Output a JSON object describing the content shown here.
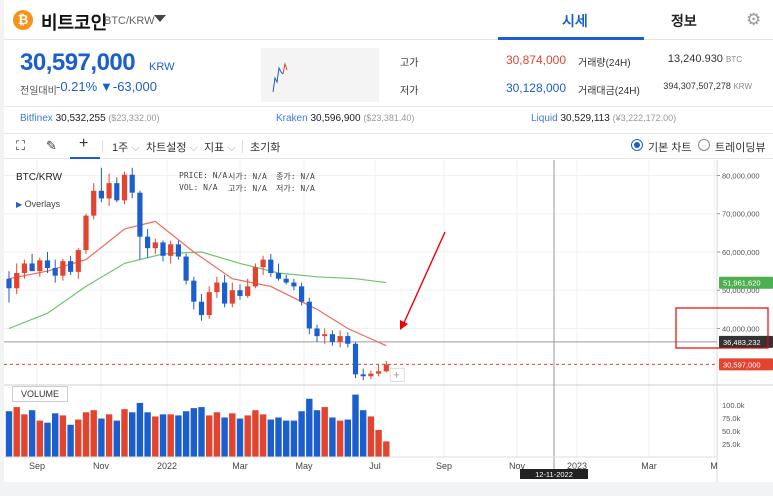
{
  "header": {
    "coin_symbol": "₿",
    "coin_name": "비트코인",
    "coin_pair": "BTC/KRW",
    "tabs": [
      {
        "label": "시세",
        "active": true
      },
      {
        "label": "정보",
        "active": false
      }
    ],
    "settings_icon": "gear-icon"
  },
  "price": {
    "current": "30,597,000",
    "unit": "KRW",
    "change_label": "전일대비",
    "change_pct": "-0.21%",
    "change_amount": "▼-63,000",
    "high_label": "고가",
    "high": "30,874,000",
    "low_label": "저가",
    "low": "30,128,000",
    "volume_label": "거래량(24H)",
    "volume": "13,240.930",
    "volume_unit": "BTC",
    "turnover_label": "거래대금(24H)",
    "turnover": "394,307,507,278",
    "turnover_unit": "KRW"
  },
  "exchanges": [
    {
      "name": "Bitfinex",
      "price": "30,532,255",
      "usd": "($23,332.00)"
    },
    {
      "name": "Kraken",
      "price": "30,596,900",
      "usd": "($23,381.40)"
    },
    {
      "name": "Liquid",
      "price": "30,529,113",
      "usd": "(¥3,222,172.00)"
    }
  ],
  "toolbar": {
    "fullscreen_icon": "fullscreen-icon",
    "pencil_icon": "pencil-icon",
    "crosshair_icon": "crosshair-icon",
    "interval": "1주",
    "chart_settings": "차트설정",
    "indicators": "지표",
    "reset": "초기화",
    "basic_chart": "기본 차트",
    "tradingview": "트레이딩뷰"
  },
  "chart_data": {
    "type": "candlestick",
    "title": "BTC/KRW",
    "overlays_label": "Overlays",
    "ohlc_labels": {
      "price": "PRICE:",
      "open": "시가:",
      "close": "종가:",
      "vol": "VOL:",
      "high": "고가:",
      "low": "저가:",
      "na": "N/A"
    },
    "volume_label": "VOLUME",
    "y_ticks": [
      "80,000,000",
      "70,000,000",
      "60,000,000",
      "50,000,000",
      "40,000,000"
    ],
    "y_range": [
      26000000,
      83000000
    ],
    "volume_ticks": [
      "100.0k",
      "75.0k",
      "50.0k",
      "25.0k"
    ],
    "volume_range": [
      0,
      125000
    ],
    "x_ticks": [
      "Sep",
      "Nov",
      "2022",
      "Mar",
      "May",
      "Jul",
      "Sep",
      "Nov",
      "2023",
      "Mar",
      "M"
    ],
    "crosshair_date": "12-11-2022",
    "crosshair_value": "36,483,232",
    "current_price_tag": "30,597,000",
    "current_price": 30597000,
    "ma_tag": "51,961,620",
    "up_color": "#e2442f",
    "down_color": "#1b5fce",
    "ma_short_color": "#f2685a",
    "ma_long_color": "#6cc56c",
    "candles": [
      {
        "o": 53.0,
        "h": 55.0,
        "l": 46.8,
        "c": 50.5
      },
      {
        "o": 50.5,
        "h": 57.0,
        "l": 49.0,
        "c": 54.5
      },
      {
        "o": 54.5,
        "h": 58.0,
        "l": 53.0,
        "c": 57.0
      },
      {
        "o": 57.0,
        "h": 59.5,
        "l": 55.0,
        "c": 55.0
      },
      {
        "o": 55.0,
        "h": 58.5,
        "l": 53.5,
        "c": 57.8
      },
      {
        "o": 57.8,
        "h": 60.0,
        "l": 54.5,
        "c": 55.8
      },
      {
        "o": 55.8,
        "h": 58.0,
        "l": 52.0,
        "c": 53.8
      },
      {
        "o": 53.8,
        "h": 58.2,
        "l": 52.5,
        "c": 57.6
      },
      {
        "o": 57.6,
        "h": 59.0,
        "l": 54.0,
        "c": 54.8
      },
      {
        "o": 54.8,
        "h": 61.0,
        "l": 53.0,
        "c": 60.5
      },
      {
        "o": 60.5,
        "h": 70.0,
        "l": 59.5,
        "c": 69.5
      },
      {
        "o": 69.5,
        "h": 78.0,
        "l": 68.5,
        "c": 76.0
      },
      {
        "o": 76.0,
        "h": 82.0,
        "l": 73.0,
        "c": 74.0
      },
      {
        "o": 74.0,
        "h": 80.5,
        "l": 72.0,
        "c": 78.0
      },
      {
        "o": 78.0,
        "h": 79.5,
        "l": 73.0,
        "c": 73.5
      },
      {
        "o": 73.5,
        "h": 81.0,
        "l": 72.5,
        "c": 80.2
      },
      {
        "o": 80.2,
        "h": 82.0,
        "l": 74.0,
        "c": 75.5
      },
      {
        "o": 75.5,
        "h": 76.0,
        "l": 58.0,
        "c": 64.0
      },
      {
        "o": 64.0,
        "h": 66.0,
        "l": 58.5,
        "c": 61.0
      },
      {
        "o": 61.0,
        "h": 63.5,
        "l": 59.5,
        "c": 62.5
      },
      {
        "o": 62.5,
        "h": 63.0,
        "l": 57.5,
        "c": 59.0
      },
      {
        "o": 59.0,
        "h": 63.0,
        "l": 57.0,
        "c": 62.0
      },
      {
        "o": 62.0,
        "h": 63.0,
        "l": 58.0,
        "c": 58.8
      },
      {
        "o": 58.8,
        "h": 59.5,
        "l": 51.5,
        "c": 52.5
      },
      {
        "o": 52.5,
        "h": 53.5,
        "l": 45.0,
        "c": 47.0
      },
      {
        "o": 47.0,
        "h": 49.0,
        "l": 42.0,
        "c": 43.5
      },
      {
        "o": 43.5,
        "h": 51.0,
        "l": 42.5,
        "c": 49.5
      },
      {
        "o": 49.5,
        "h": 53.5,
        "l": 48.0,
        "c": 52.0
      },
      {
        "o": 52.0,
        "h": 54.0,
        "l": 45.5,
        "c": 46.5
      },
      {
        "o": 46.5,
        "h": 52.0,
        "l": 45.5,
        "c": 50.0
      },
      {
        "o": 50.0,
        "h": 51.5,
        "l": 47.5,
        "c": 48.5
      },
      {
        "o": 48.5,
        "h": 53.0,
        "l": 48.0,
        "c": 51.0
      },
      {
        "o": 51.0,
        "h": 57.0,
        "l": 50.5,
        "c": 56.0
      },
      {
        "o": 56.0,
        "h": 59.0,
        "l": 54.0,
        "c": 58.0
      },
      {
        "o": 58.0,
        "h": 59.5,
        "l": 53.5,
        "c": 54.5
      },
      {
        "o": 54.5,
        "h": 57.0,
        "l": 52.5,
        "c": 53.0
      },
      {
        "o": 53.0,
        "h": 54.0,
        "l": 51.5,
        "c": 52.0
      },
      {
        "o": 52.0,
        "h": 53.0,
        "l": 50.0,
        "c": 51.0
      },
      {
        "o": 51.0,
        "h": 52.0,
        "l": 46.0,
        "c": 47.0
      },
      {
        "o": 47.0,
        "h": 48.0,
        "l": 38.5,
        "c": 40.0
      },
      {
        "o": 40.0,
        "h": 41.0,
        "l": 36.5,
        "c": 38.0
      },
      {
        "o": 38.0,
        "h": 40.0,
        "l": 36.0,
        "c": 38.5
      },
      {
        "o": 38.5,
        "h": 39.5,
        "l": 35.5,
        "c": 36.5
      },
      {
        "o": 36.5,
        "h": 39.5,
        "l": 35.0,
        "c": 38.0
      },
      {
        "o": 38.0,
        "h": 39.0,
        "l": 35.0,
        "c": 36.0
      },
      {
        "o": 36.0,
        "h": 36.5,
        "l": 27.0,
        "c": 28.0
      },
      {
        "o": 28.0,
        "h": 29.5,
        "l": 26.5,
        "c": 27.5
      },
      {
        "o": 27.5,
        "h": 29.0,
        "l": 26.8,
        "c": 28.2
      },
      {
        "o": 28.2,
        "h": 30.5,
        "l": 27.5,
        "c": 28.8
      },
      {
        "o": 28.8,
        "h": 31.5,
        "l": 28.5,
        "c": 30.6
      }
    ],
    "volume": [
      88,
      96,
      82,
      90,
      70,
      66,
      84,
      80,
      62,
      72,
      86,
      90,
      74,
      82,
      70,
      92,
      86,
      104,
      86,
      78,
      82,
      82,
      80,
      88,
      94,
      96,
      80,
      86,
      76,
      84,
      74,
      80,
      90,
      82,
      72,
      76,
      70,
      70,
      88,
      112,
      90,
      96,
      76,
      70,
      72,
      120,
      90,
      78,
      52,
      30
    ],
    "ma_short": [
      [
        0,
        53
      ],
      [
        5,
        55
      ],
      [
        10,
        58
      ],
      [
        15,
        66
      ],
      [
        19,
        68
      ],
      [
        24,
        60
      ],
      [
        29,
        53
      ],
      [
        34,
        51
      ],
      [
        40,
        45
      ],
      [
        44,
        40
      ],
      [
        49,
        35.5
      ]
    ],
    "ma_long": [
      [
        0,
        40
      ],
      [
        5,
        44
      ],
      [
        10,
        51
      ],
      [
        15,
        57
      ],
      [
        20,
        59.5
      ],
      [
        25,
        60
      ],
      [
        30,
        57
      ],
      [
        35,
        54.5
      ],
      [
        40,
        53.5
      ],
      [
        45,
        53
      ],
      [
        49,
        52
      ]
    ]
  }
}
